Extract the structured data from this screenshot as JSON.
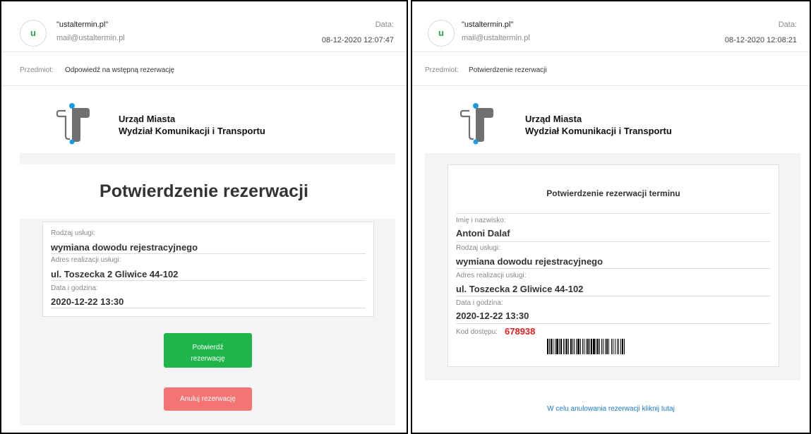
{
  "left": {
    "sender_initial": "u",
    "sender_name": "\"ustaltermin.pl\"",
    "sender_email": "mail@ustaltermin.pl",
    "date_label": "Data:",
    "date_value": "08-12-2020 12:07:47",
    "subject_label": "Przedmiot:",
    "subject_text": "Odpowiedź na wstępną rezerwację",
    "org_line1": "Urząd Miasta",
    "org_line2": "Wydział Komunikacji i Transportu",
    "title": "Potwierdzenie rezerwacji",
    "fields": [
      {
        "label": "Rodzaj usługi:",
        "value": "wymiana dowodu rejestracyjnego"
      },
      {
        "label": "Adres realizacji usługi:",
        "value": "ul. Toszecka 2 Gliwice 44-102"
      },
      {
        "label": "Data i godzina:",
        "value": "2020-12-22 13:30"
      }
    ],
    "confirm_line1": "Potwierdź",
    "confirm_line2": "rezerwację",
    "cancel_label": "Anuluj rezerwację"
  },
  "right": {
    "sender_initial": "u",
    "sender_name": "\"ustaltermin.pl\"",
    "sender_email": "mail@ustaltermin.pl",
    "date_label": "Data:",
    "date_value": "08-12-2020 12:08:21",
    "subject_label": "Przedmiot:",
    "subject_text": "Potwierdzenie rezerwacji",
    "org_line1": "Urząd Miasta",
    "org_line2": "Wydział Komunikacji i Transportu",
    "card_title": "Potwierdzenie rezerwacji terminu",
    "fields": [
      {
        "label": "Imię i nazwisko:",
        "value": "Antoni Dalaf"
      },
      {
        "label": "Rodzaj usługi:",
        "value": "wymiana dowodu rejestracyjnego"
      },
      {
        "label": "Adres realizacji usługi:",
        "value": "ul. Toszecka 2 Gliwice 44-102"
      },
      {
        "label": "Data i godzina:",
        "value": "2020-12-22 13:30"
      }
    ],
    "access_label": "Kod dostępu:",
    "access_code": "678938",
    "barcode_icon": "barcode-icon",
    "cancel_link": "W celu anulowania rezerwacji kliknij tutaj"
  },
  "colors": {
    "accent_green": "#20b54a",
    "cancel_red": "#f47373",
    "code_red": "#e21f1f",
    "logo_gray": "#707070",
    "logo_blue": "#1e9be0",
    "link_blue": "#1a7ad4"
  }
}
